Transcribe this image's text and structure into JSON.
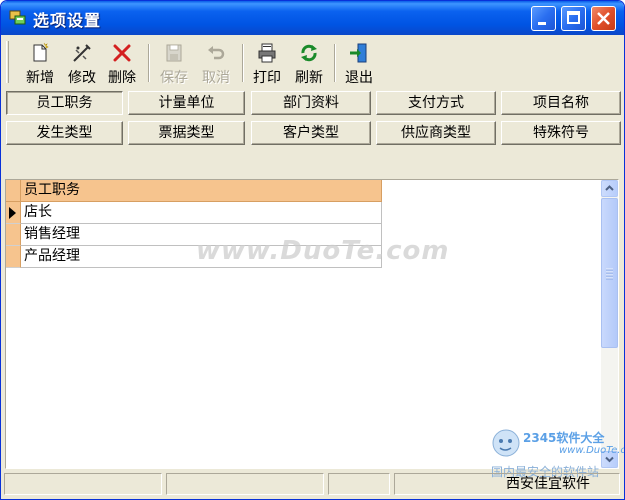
{
  "window": {
    "title": "选项设置"
  },
  "toolbar": {
    "buttons": [
      {
        "label": "新增",
        "icon": "new-file-icon",
        "enabled": true
      },
      {
        "label": "修改",
        "icon": "edit-icon",
        "enabled": true
      },
      {
        "label": "删除",
        "icon": "delete-x-icon",
        "enabled": true
      },
      {
        "label": "保存",
        "icon": "save-icon",
        "enabled": false
      },
      {
        "label": "取消",
        "icon": "undo-icon",
        "enabled": false
      },
      {
        "label": "打印",
        "icon": "printer-icon",
        "enabled": true
      },
      {
        "label": "刷新",
        "icon": "refresh-icon",
        "enabled": true
      },
      {
        "label": "退出",
        "icon": "exit-door-icon",
        "enabled": true
      }
    ]
  },
  "tabs": {
    "row1": [
      "员工职务",
      "计量单位",
      "部门资料",
      "支付方式",
      "项目名称"
    ],
    "row2": [
      "发生类型",
      "票据类型",
      "客户类型",
      "供应商类型",
      "特殊符号"
    ],
    "active": "员工职务"
  },
  "grid": {
    "header": "员工职务",
    "rows": [
      "店长",
      "销售经理",
      "产品经理"
    ],
    "current_row_index": 0
  },
  "watermark": {
    "text": "www.DuoTe.com"
  },
  "logo": {
    "line1": "2345软件大全",
    "line2": "国内最安全的软件站",
    "url": "www.DuoTe.com"
  },
  "status": {
    "company": "西安佳宜软件"
  },
  "colors": {
    "title_bar": "#0054e3",
    "grid_header": "#f6c48e",
    "window_bg": "#ece9d8"
  }
}
